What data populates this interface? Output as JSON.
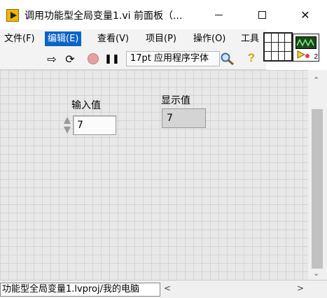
{
  "window": {
    "title": "调用功能型全局变量1.vi 前面板（...",
    "minimize_glyph": "—",
    "maximize_glyph": "☐",
    "close_glyph": "✕"
  },
  "menu": {
    "items": [
      {
        "label": "文件(F)",
        "active": false
      },
      {
        "label": "编辑(E)",
        "active": true
      },
      {
        "label": "查看(V)",
        "active": false
      },
      {
        "label": "项目(P)",
        "active": false
      },
      {
        "label": "操作(O)",
        "active": false
      },
      {
        "label": "工具",
        "active": false
      }
    ]
  },
  "toolbar": {
    "run_icon": "⇨",
    "run_continuously_icon": "⟳",
    "pause_icon": "❚❚",
    "font_select": "17pt 应用程序字体",
    "help_icon": "?"
  },
  "vi_icon": {
    "badge": "2"
  },
  "panel": {
    "input_control": {
      "label": "输入值",
      "value": "7"
    },
    "display_indicator": {
      "label": "显示值",
      "value": "7"
    }
  },
  "scrollbars": {
    "up_glyph": "⌃",
    "down_glyph": "⌄",
    "left_glyph": "<",
    "right_glyph": ">"
  },
  "status": {
    "project_path": "功能型全局变量1.lvproj/我的电脑"
  },
  "colors": {
    "menu_active": "#0a64c8",
    "panel_grid": "#e8e8e8"
  }
}
